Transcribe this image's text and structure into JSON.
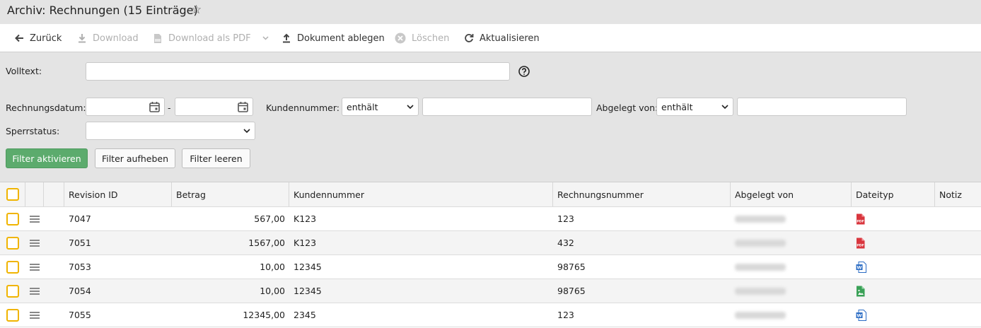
{
  "title": "Archiv: Rechnungen (15 Einträge)",
  "toolbar": {
    "back": "Zurück",
    "download": "Download",
    "download_pdf": "Download als PDF",
    "upload": "Dokument ablegen",
    "delete": "Löschen",
    "refresh": "Aktualisieren"
  },
  "filter": {
    "fulltext_label": "Volltext:",
    "fulltext_value": "",
    "invoice_date_label": "Rechnungsdatum:",
    "date_from": "",
    "date_separator": "-",
    "date_to": "",
    "customer_label": "Kundennummer:",
    "customer_op": "enthält",
    "customer_value": "",
    "filed_by_label": "Abgelegt von:",
    "filed_by_op": "enthält",
    "filed_by_value": "",
    "lock_label": "Sperrstatus:",
    "lock_value": "",
    "apply": "Filter aktivieren",
    "remove": "Filter aufheben",
    "clear": "Filter leeren"
  },
  "table": {
    "columns": [
      "Revision ID",
      "Betrag",
      "Kundennummer",
      "Rechnungsnummer",
      "Abgelegt von",
      "Dateityp",
      "Notiz"
    ],
    "rows": [
      {
        "revision": "7047",
        "amount": "567,00",
        "customer": "K123",
        "invoice": "123",
        "filetype": "pdf"
      },
      {
        "revision": "7051",
        "amount": "1567,00",
        "customer": "K123",
        "invoice": "432",
        "filetype": "pdf"
      },
      {
        "revision": "7053",
        "amount": "10,00",
        "customer": "12345",
        "invoice": "98765",
        "filetype": "word"
      },
      {
        "revision": "7054",
        "amount": "10,00",
        "customer": "12345",
        "invoice": "98765",
        "filetype": "image"
      },
      {
        "revision": "7055",
        "amount": "12345,00",
        "customer": "2345",
        "invoice": "123",
        "filetype": "word"
      }
    ]
  },
  "colors": {
    "accent_green": "#5cab6d",
    "checkbox_yellow": "#f0b400",
    "pdf_red": "#d9363e",
    "word_blue": "#2b6cc4",
    "image_green": "#3aa157"
  }
}
